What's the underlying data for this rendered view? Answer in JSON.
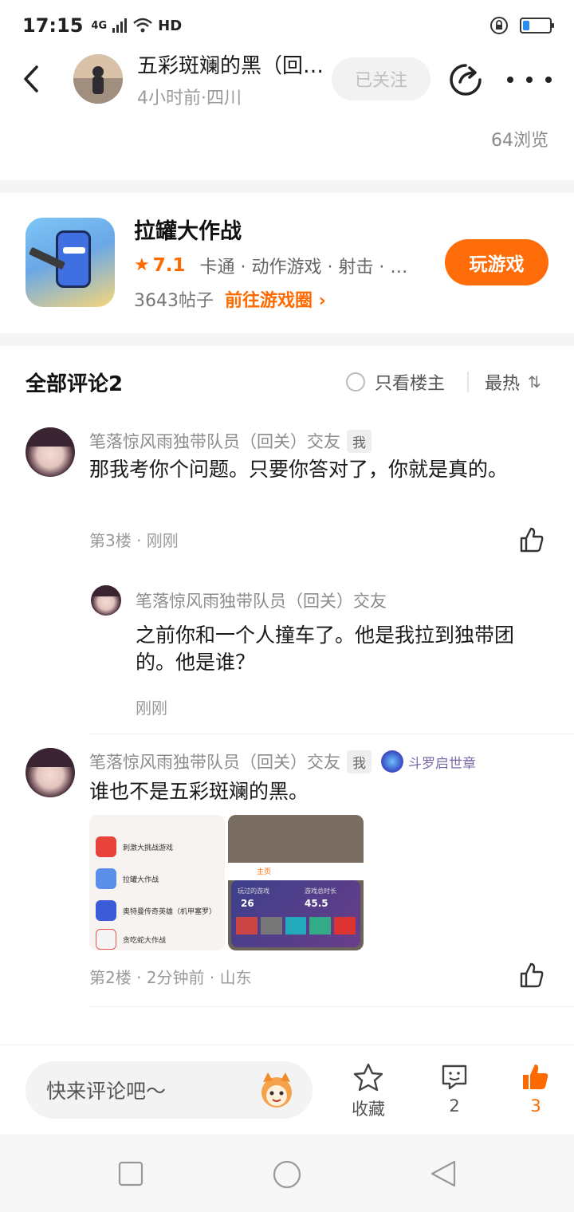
{
  "status_bar": {
    "time": "17:15",
    "network": "4G",
    "signal_label": "HD"
  },
  "header": {
    "author_name": "五彩斑斓的黑（回…",
    "author_meta": "4小时前·四川",
    "follow_label": "已关注",
    "views": "64浏览"
  },
  "game": {
    "name": "拉罐大作战",
    "rating": "7.1",
    "tags": "卡通 · 动作游戏 · 射击 · …",
    "post_count": "3643帖子",
    "goto_label": "前往游戏圈",
    "play_label": "玩游戏"
  },
  "comments_section": {
    "title": "全部评论2",
    "only_op": "只看楼主",
    "sort_label": "最热"
  },
  "comments": [
    {
      "author": "笔落惊风雨独带队员（回关）交友",
      "me_badge": "我",
      "text": "那我考你个问题。只要你答对了，你就是真的。",
      "meta": "第3楼 · 刚刚"
    },
    {
      "author": "笔落惊风雨独带队员（回关）交友",
      "text": "之前你和一个人撞车了。他是我拉到独带团的。他是谁？",
      "meta": "刚刚"
    },
    {
      "author": "笔落惊风雨独带队员（回关）交友",
      "me_badge": "我",
      "medal": "斗罗启世章",
      "text": "谁也不是五彩斑斓的黑。",
      "meta": "第2楼 · 2分钟前 · 山东"
    }
  ],
  "screenshot_thumb": {
    "rows": [
      "拉罐大作战",
      "奥特曼传奇英雄（机甲塞罗）",
      "贪吃蛇大作战",
      "刺激大挑战游戏"
    ],
    "stats_label_1": "玩过的游戏",
    "stats_value_1": "26",
    "stats_label_2": "游戏总时长",
    "stats_value_2": "45.5",
    "tab_home": "主页"
  },
  "bottom_bar": {
    "input_placeholder": "快来评论吧～",
    "collect_label": "收藏",
    "comment_count": "2",
    "like_count": "3"
  },
  "colors": {
    "accent": "#ff6a00",
    "follow_bg": "#f2f2f2",
    "muted": "#9a9a9a"
  }
}
